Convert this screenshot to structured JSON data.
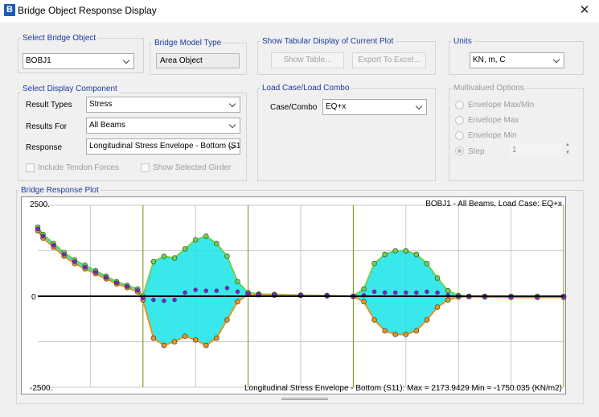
{
  "window": {
    "title": "Bridge Object Response Display",
    "icon_letter": "B",
    "close_glyph": "✕"
  },
  "select_object": {
    "label": "Select Bridge Object",
    "value": "BOBJ1"
  },
  "model_type": {
    "label": "Bridge Model Type",
    "value": "Area Object"
  },
  "tabular": {
    "label": "Show Tabular Display of Current Plot",
    "show_table": "Show Table...",
    "export_excel": "Export To Excel..."
  },
  "units": {
    "label": "Units",
    "value": "KN, m, C"
  },
  "display_component": {
    "label": "Select Display Component",
    "result_types_label": "Result Types",
    "result_types_value": "Stress",
    "results_for_label": "Results For",
    "results_for_value": "All Beams",
    "response_label": "Response",
    "response_value": "Longitudinal Stress Envelope - Bottom (S1",
    "include_tendon_label": "Include Tendon Forces",
    "include_tendon_checked": false,
    "show_girder_label": "Show Selected Girder",
    "show_girder_checked": false
  },
  "load_case": {
    "label": "Load Case/Load Combo",
    "combo_label": "Case/Combo",
    "combo_value": "EQ+x"
  },
  "multivalued": {
    "label": "Multivalued Options",
    "envelope_maxmin": "Envelope Max/Min",
    "envelope_max": "Envelope Max",
    "envelope_min": "Envelope Min",
    "step": "Step",
    "step_value": "1",
    "selected": "step"
  },
  "plot": {
    "label": "Bridge Response Plot",
    "header_text": "BOBJ1 - All Beams,  Load Case: EQ+x",
    "footer_text": "Longitudinal Stress Envelope - Bottom (S11):  Max = 2173.9429    Min = -1750.035  (KN/m2)",
    "y_top_label": "2500.",
    "y_zero_label": "0",
    "y_bottom_label": "-2500.",
    "colors": {
      "cyan": "#15e4e8",
      "orange": "#e8921e",
      "green": "#6dd14c",
      "purple": "#7b1fd0",
      "span_line": "#7a9a1a",
      "axis": "#000000",
      "grid": "#c8c8c8"
    }
  },
  "chart_data": {
    "type": "line",
    "title": "BOBJ1 - All Beams,  Load Case: EQ+x",
    "xlabel": "",
    "ylabel": "",
    "ylim": [
      -2500,
      2500
    ],
    "y_ticks": [
      "2500.",
      "0",
      "-2500."
    ],
    "summary": {
      "quantity": "Longitudinal Stress Envelope - Bottom (S11)",
      "max": 2173.9429,
      "min": -1750.035,
      "units": "KN/m2"
    },
    "span_boundaries_fraction": [
      0.2,
      0.4,
      0.6,
      1.0
    ],
    "envelope_fraction_x": [
      0.0,
      0.01,
      0.03,
      0.05,
      0.07,
      0.09,
      0.11,
      0.13,
      0.15,
      0.17,
      0.19,
      0.2,
      0.22,
      0.24,
      0.26,
      0.28,
      0.3,
      0.32,
      0.34,
      0.36,
      0.38,
      0.4,
      0.42,
      0.45,
      0.5,
      0.55,
      0.6,
      0.62,
      0.64,
      0.66,
      0.68,
      0.7,
      0.72,
      0.74,
      0.76,
      0.78,
      0.8,
      0.82,
      0.85,
      0.9,
      0.95,
      1.0
    ],
    "series": [
      {
        "values": [
          1900,
          1700,
          1450,
          1200,
          1000,
          850,
          700,
          550,
          400,
          300,
          200,
          0,
          950,
          1100,
          1050,
          1300,
          1550,
          1650,
          1450,
          1100,
          400,
          100,
          60,
          50,
          30,
          20,
          0,
          200,
          900,
          1150,
          1250,
          1250,
          1150,
          900,
          500,
          150,
          20,
          0,
          0,
          0,
          0,
          0
        ]
      },
      {
        "values": [
          1800,
          1600,
          1350,
          1100,
          900,
          750,
          620,
          480,
          340,
          240,
          120,
          -100,
          -1150,
          -1350,
          -1250,
          -1100,
          -1200,
          -1350,
          -1150,
          -650,
          -150,
          50,
          40,
          30,
          20,
          10,
          0,
          -150,
          -650,
          -950,
          -1050,
          -1050,
          -950,
          -650,
          -300,
          -100,
          -20,
          -10,
          -20,
          -30,
          -30,
          -30
        ]
      }
    ]
  }
}
